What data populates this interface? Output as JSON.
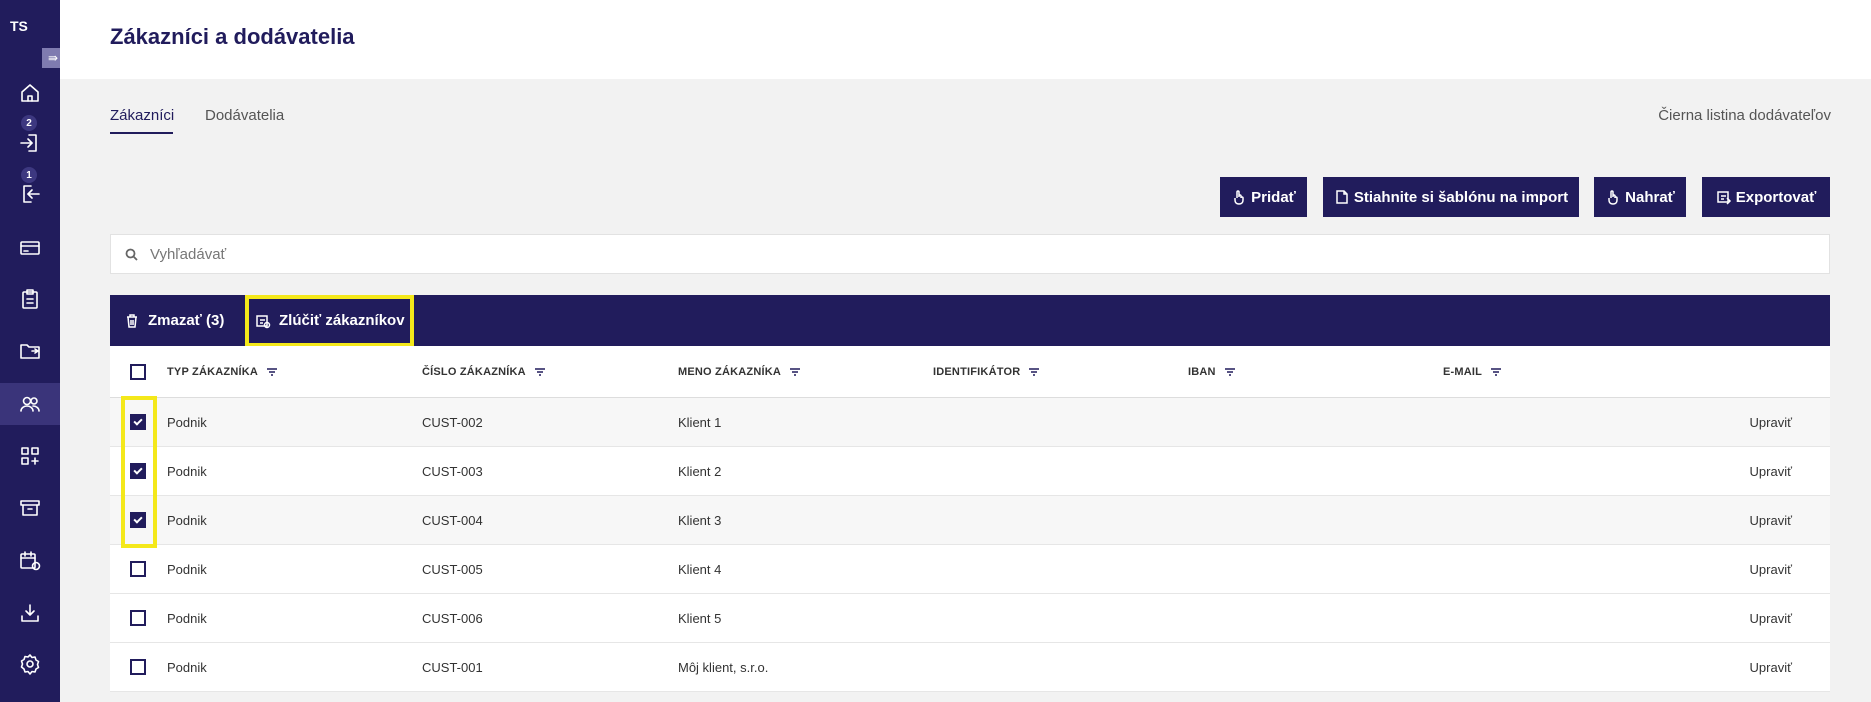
{
  "sidebar": {
    "logo": "TS",
    "toggle_icon": "⇛",
    "items": [
      {
        "icon": "home-icon",
        "active": false
      },
      {
        "icon": "incoming-icon",
        "active": false,
        "badge": "2"
      },
      {
        "icon": "outgoing-icon",
        "active": false,
        "badge": "1"
      },
      {
        "icon": "card-icon",
        "active": false
      },
      {
        "icon": "clipboard-icon",
        "active": false
      },
      {
        "icon": "transfer-icon",
        "active": false
      },
      {
        "icon": "customers-icon",
        "active": true
      },
      {
        "icon": "apps-add-icon",
        "active": false
      },
      {
        "icon": "archive-icon",
        "active": false
      },
      {
        "icon": "calendar-refresh-icon",
        "active": false
      },
      {
        "icon": "download-icon",
        "active": false
      },
      {
        "icon": "settings-icon",
        "active": false
      }
    ]
  },
  "header": {
    "title": "Zákazníci a dodávatelia"
  },
  "tabs": [
    {
      "label": "Zákazníci",
      "active": true
    },
    {
      "label": "Dodávatelia",
      "active": false
    }
  ],
  "blacklist_link": "Čierna listina dodávateľov",
  "actions": {
    "add": "Pridať",
    "template": "Stiahnite si šablónu na import",
    "upload": "Nahrať",
    "export": "Exportovať"
  },
  "search": {
    "placeholder": "Vyhľadávať"
  },
  "bulk": {
    "delete": "Zmazať (3)",
    "merge": "Zlúčiť zákazníkov"
  },
  "table": {
    "columns": [
      "TYP ZÁKAZNÍKA",
      "ČÍSLO ZÁKAZNÍKA",
      "MENO ZÁKAZNÍKA",
      "IDENTIFIKÁTOR",
      "IBAN",
      "E-MAIL"
    ],
    "edit_label": "Upraviť",
    "rows": [
      {
        "checked": true,
        "type": "Podnik",
        "number": "CUST-002",
        "name": "Klient 1"
      },
      {
        "checked": true,
        "type": "Podnik",
        "number": "CUST-003",
        "name": "Klient 2"
      },
      {
        "checked": true,
        "type": "Podnik",
        "number": "CUST-004",
        "name": "Klient 3"
      },
      {
        "checked": false,
        "type": "Podnik",
        "number": "CUST-005",
        "name": "Klient 4"
      },
      {
        "checked": false,
        "type": "Podnik",
        "number": "CUST-006",
        "name": "Klient 5"
      },
      {
        "checked": false,
        "type": "Podnik",
        "number": "CUST-001",
        "name": "Môj klient, s.r.o."
      }
    ]
  },
  "colors": {
    "brand": "#211c5c",
    "highlight": "#f4e81a"
  }
}
